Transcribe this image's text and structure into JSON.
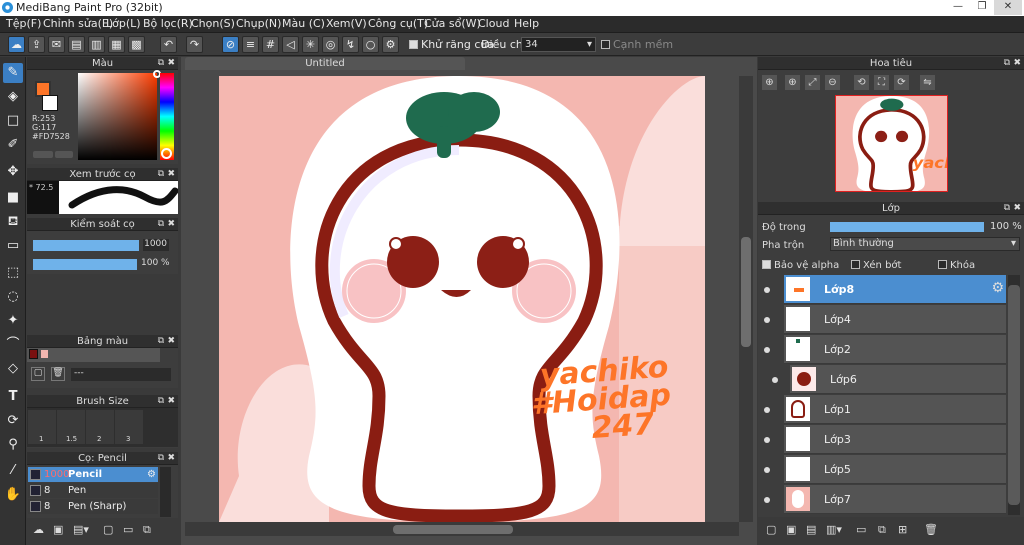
{
  "window": {
    "title": "MediBang Paint Pro (32bit)",
    "min": "—",
    "max": "❐",
    "close": "✕"
  },
  "menu": [
    "Tệp(F)",
    "Chỉnh sửa(E)",
    "Lớp(L)",
    "Bộ lọc(R)",
    "Chọn(S)",
    "Chụp(N)",
    "Màu (C)",
    "Xem(V)",
    "Công cụ(T)",
    "Cửa sổ(W)",
    "Cloud",
    "Help"
  ],
  "toolbar": {
    "antialias_label": "Khử răng cưa",
    "strength_label": "Điều chỉnh",
    "strength_value": "34",
    "edge_label": "Cạnh mềm"
  },
  "color_panel": {
    "title": "Màu",
    "r": "R:253",
    "g": "G:117",
    "hex": "#FD7528",
    "fg_color": "#FD7528",
    "bg_color": "#FFFFFF"
  },
  "brush_preview": {
    "title": "Xem trước cọ",
    "size_value": "72.5"
  },
  "brush_control": {
    "title": "Kiểm soát cọ",
    "size": "1000",
    "opacity": "100 %"
  },
  "palette": {
    "title": "Bảng màu",
    "input": "---",
    "colors": [
      "#7a1010",
      "#f2b6b0"
    ]
  },
  "brush_size": {
    "title": "Brush Size",
    "sizes": [
      "1",
      "1.5",
      "2",
      "3"
    ]
  },
  "brush_list": {
    "title": "Cọ: Pencil",
    "items": [
      {
        "size": "1000",
        "name": "Pencil"
      },
      {
        "size": "8",
        "name": "Pen"
      },
      {
        "size": "8",
        "name": "Pen (Sharp)"
      }
    ]
  },
  "document": {
    "tab": "Untitled"
  },
  "navigator": {
    "title": "Hoa tiêu"
  },
  "layers": {
    "title": "Lớp",
    "opacity_label": "Độ trong",
    "opacity_value": "100 %",
    "opacity_fraction": 1.0,
    "blend_label": "Pha trộn",
    "blend_value": "Bình thường",
    "protect_alpha": "Bảo vệ alpha",
    "clipping": "Xén bớt",
    "lock": "Khóa",
    "items": [
      "Lớp8",
      "Lớp4",
      "Lớp2",
      "Lớp6",
      "Lớp1",
      "Lớp3",
      "Lớp5",
      "Lớp7"
    ]
  },
  "artwork_text": [
    "yachiko",
    "#Hoidap",
    "247"
  ],
  "colors": {
    "accent": "#4b8ed0",
    "background_pink": "#f4b7b0",
    "outline": "#8a1d12",
    "leaf": "#1f6b4e",
    "signature": "#fd7528"
  }
}
